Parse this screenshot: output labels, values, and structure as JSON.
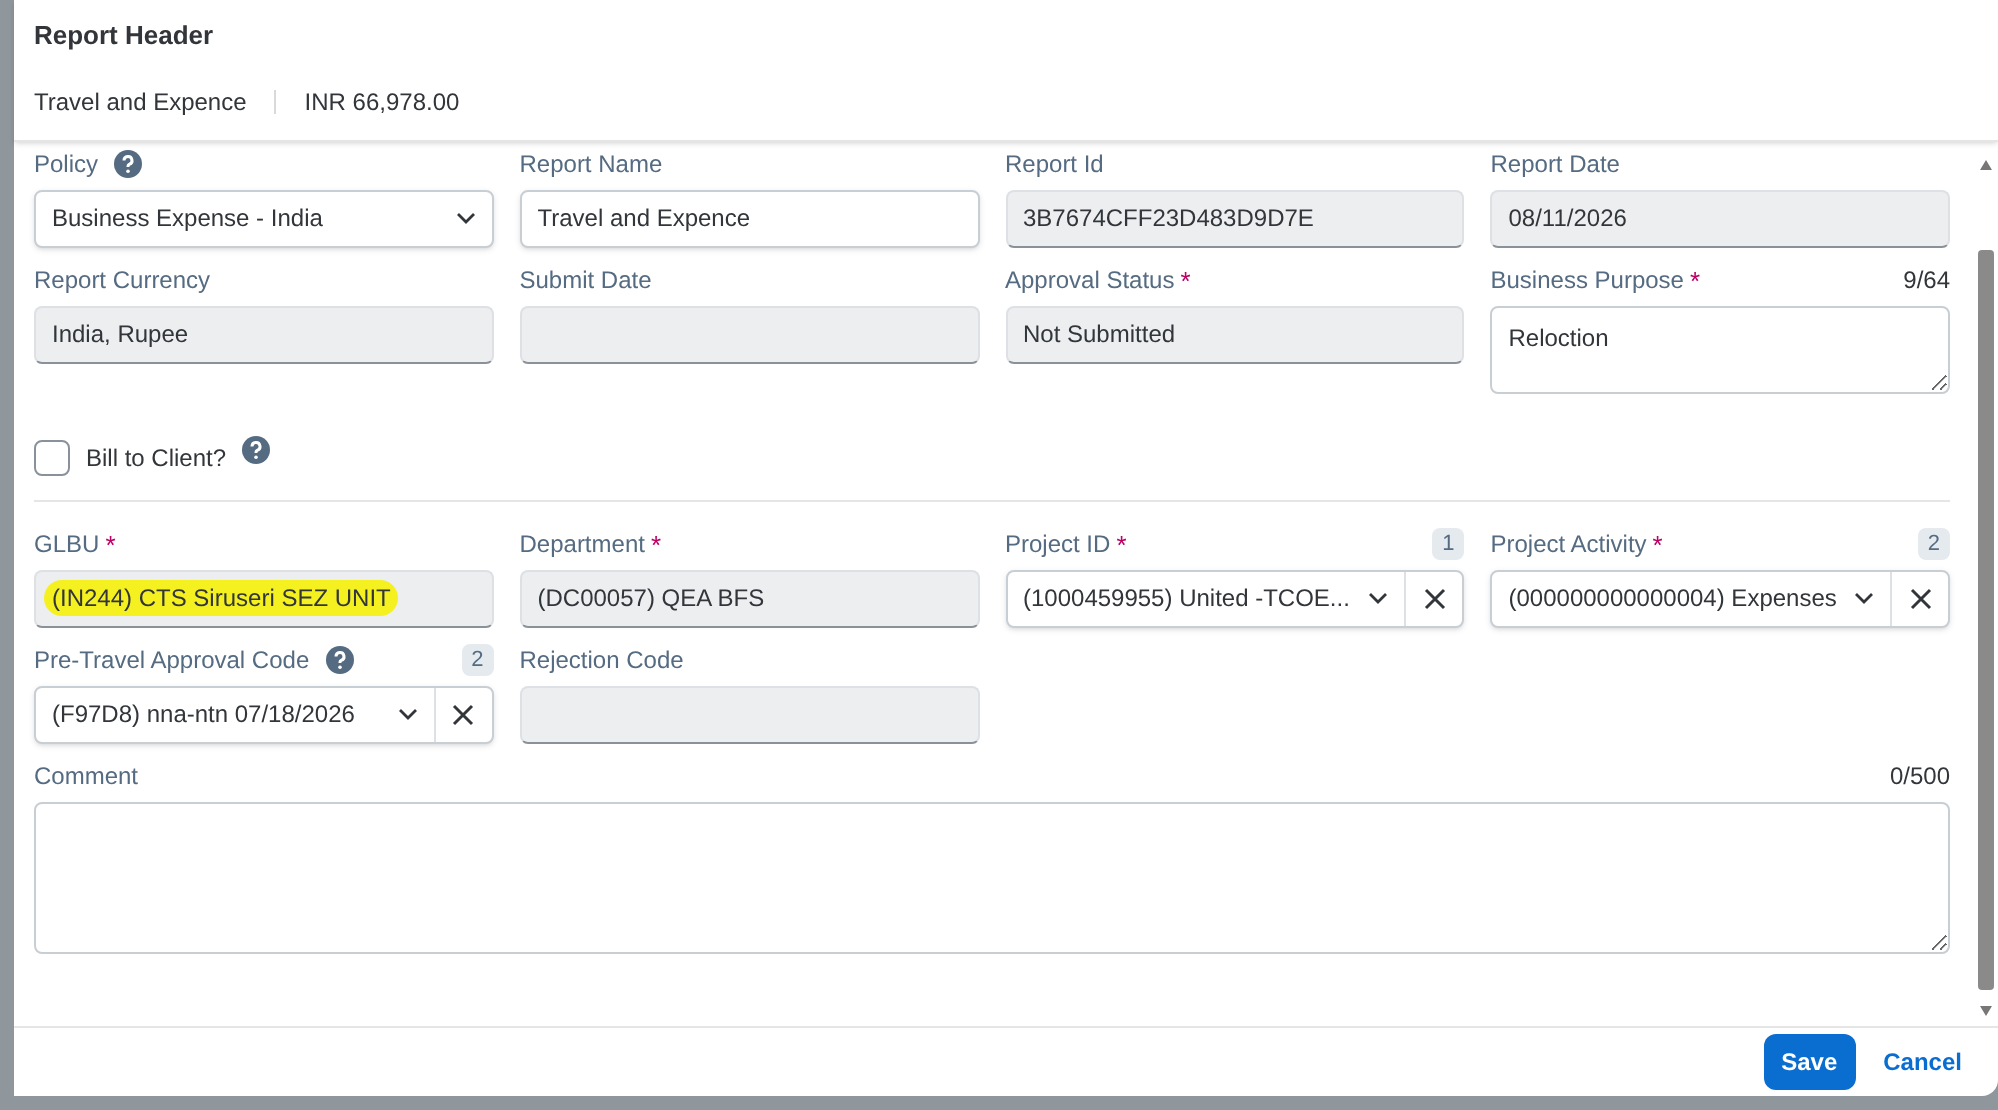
{
  "header": {
    "title": "Report Header",
    "report_name": "Travel and Expence",
    "amount": "INR 66,978.00"
  },
  "sections": [
    {
      "fields": [
        {
          "kind": "select",
          "label": "Policy",
          "help": true,
          "value": "Business Expense - India"
        },
        {
          "kind": "text",
          "label": "Report Name",
          "value": "Travel and Expence"
        },
        {
          "kind": "readonly",
          "label": "Report Id",
          "value": "3B7674CFF23D483D9D7E"
        },
        {
          "kind": "readonly",
          "label": "Report Date",
          "value": "08/11/2026"
        },
        {
          "kind": "readonly",
          "label": "Report Currency",
          "value": "India, Rupee"
        },
        {
          "kind": "readonly",
          "label": "Submit Date"
        },
        {
          "kind": "readonly",
          "label": "Approval Status",
          "required_mark": "*",
          "value": "Not Submitted"
        },
        {
          "kind": "textarea",
          "label": "Business Purpose",
          "required_mark": "*",
          "counter": "9/64",
          "value": "Reloction"
        },
        {
          "kind": "checkbox",
          "label": "Bill to Client?",
          "help": true,
          "checked": false
        }
      ]
    },
    {
      "fields": [
        {
          "kind": "readonly",
          "label": "GLBU",
          "required_mark": "*",
          "highlighted": true,
          "value": "(IN244) CTS Siruseri SEZ UNIT"
        },
        {
          "kind": "readonly",
          "label": "Department",
          "required_mark": "*",
          "value": "(DC00057) QEA BFS"
        },
        {
          "kind": "combo",
          "label": "Project ID",
          "required_mark": "*",
          "badge": "1",
          "value": "(1000459955) United -TCOE..."
        },
        {
          "kind": "combo",
          "label": "Project Activity",
          "required_mark": "*",
          "badge": "2",
          "value": "(000000000000004) Expenses"
        },
        {
          "kind": "combo",
          "label": "Pre-Travel Approval Code",
          "help": true,
          "badge": "2",
          "value": "(F97D8) nna-ntn 07/18/2026"
        },
        {
          "kind": "readonly",
          "label": "Rejection Code"
        },
        {
          "kind": "long_text",
          "label": "Comment",
          "counter": "0/500"
        }
      ]
    }
  ],
  "buttons": [
    {
      "kind": "primary",
      "label": "Save"
    },
    {
      "kind": "plain",
      "label": "Cancel"
    }
  ]
}
